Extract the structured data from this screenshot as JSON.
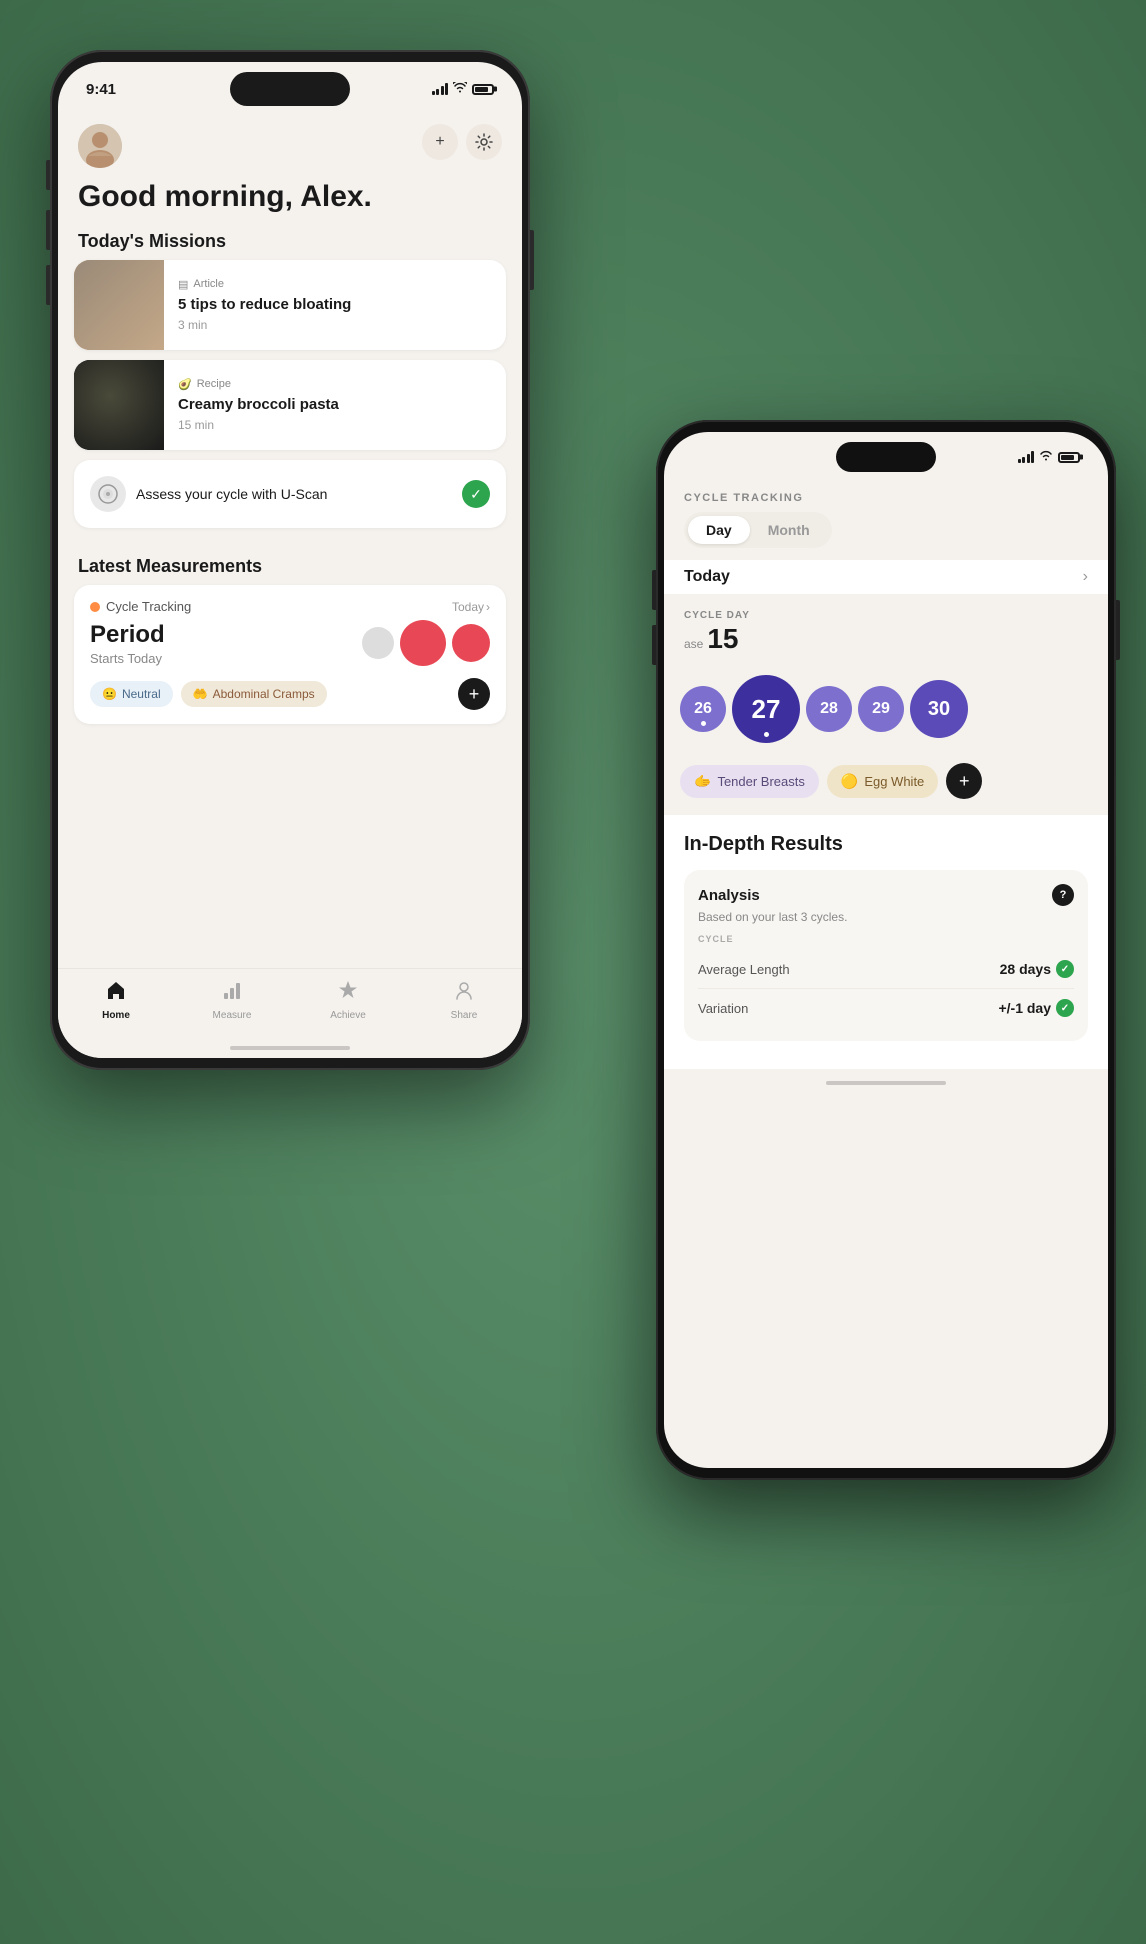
{
  "phone1": {
    "status": {
      "time": "9:41"
    },
    "greeting": "Good morning, Alex.",
    "sections": {
      "missions": "Today's Missions",
      "measurements": "Latest Measurements"
    },
    "missions": [
      {
        "type": "Article",
        "title": "5 tips to reduce bloating",
        "duration": "3 min",
        "image": "article"
      },
      {
        "type": "Recipe",
        "title": "Creamy broccoli pasta",
        "duration": "15 min",
        "image": "recipe"
      }
    ],
    "uscan": {
      "text": "Assess your cycle with U-Scan"
    },
    "measurement": {
      "label": "Cycle Tracking",
      "today_link": "Today",
      "title": "Period",
      "subtitle": "Starts Today"
    },
    "symptoms": [
      {
        "label": "Neutral",
        "type": "neutral"
      },
      {
        "label": "Abdominal Cramps",
        "type": "cramps"
      }
    ],
    "nav": [
      {
        "label": "Home",
        "active": true,
        "icon": "🏠"
      },
      {
        "label": "Measure",
        "active": false,
        "icon": "📊"
      },
      {
        "label": "Achieve",
        "active": false,
        "icon": "⭐"
      },
      {
        "label": "Share",
        "active": false,
        "icon": "👤"
      }
    ]
  },
  "phone2": {
    "page_title": "CYCLE TRACKING",
    "day_month_toggle": {
      "day": "Day",
      "month": "Month"
    },
    "today": "Today",
    "cycle_day_label": "CYCLE DAY",
    "cycle_day": "15",
    "phase": "ase",
    "calendar_days": [
      {
        "num": "26",
        "size": "small",
        "dot": true
      },
      {
        "num": "27",
        "size": "large",
        "dot": true
      },
      {
        "num": "28",
        "size": "small",
        "dot": false
      },
      {
        "num": "29",
        "size": "small",
        "dot": false
      },
      {
        "num": "30",
        "size": "large-extra",
        "dot": false
      }
    ],
    "symptoms": [
      {
        "label": "Tender Breasts",
        "type": "tender"
      },
      {
        "label": "Egg White",
        "type": "egg"
      }
    ],
    "results": {
      "title": "In-Depth Results",
      "analysis_title": "Analysis",
      "analysis_subtitle": "Based on your last 3 cycles.",
      "cycle_section": "CYCLE",
      "metrics": [
        {
          "name": "Average Length",
          "value": "28 days",
          "check": true
        },
        {
          "name": "Variation",
          "value": "+/-1 day",
          "check": true
        }
      ]
    }
  }
}
